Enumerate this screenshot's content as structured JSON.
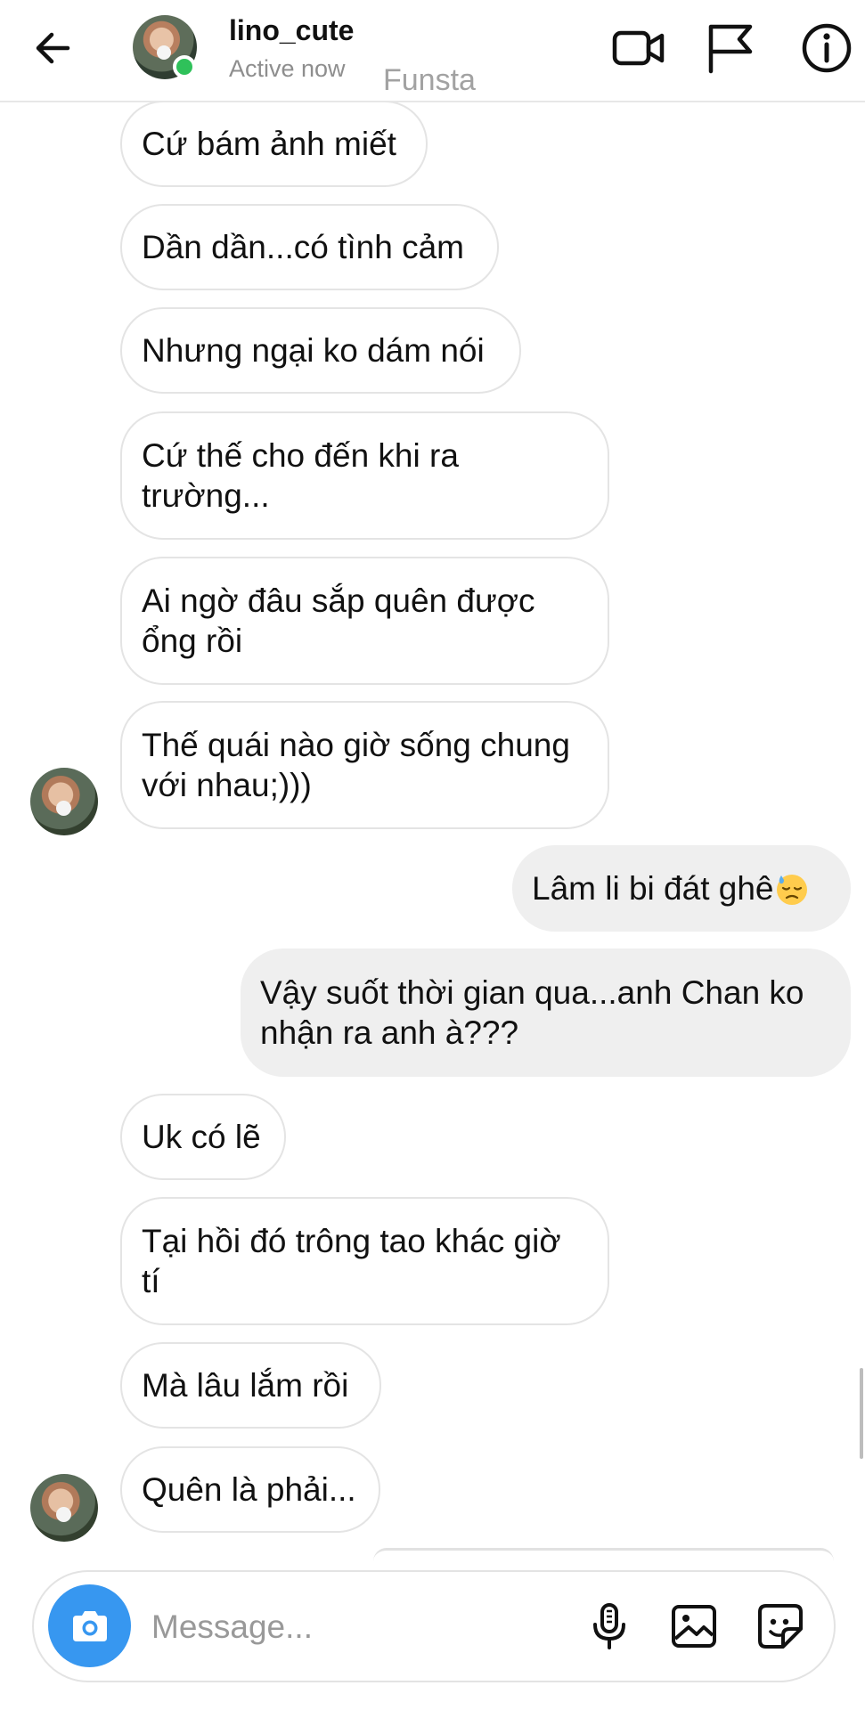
{
  "header": {
    "username": "lino_cute",
    "status": "Active now",
    "watermark": "Funsta"
  },
  "messages": [
    {
      "side": "in",
      "text": "Cứ bám ảnh miết"
    },
    {
      "side": "in",
      "text": "Dần dần...có tình cảm"
    },
    {
      "side": "in",
      "text": "Nhưng ngại ko dám nói"
    },
    {
      "side": "in",
      "text": "Cứ thế cho đến khi ra trường..."
    },
    {
      "side": "in",
      "text": "Ai ngờ đâu sắp quên được ổng rồi"
    },
    {
      "side": "in",
      "text": "Thế quái nào giờ sống chung với nhau;)))"
    },
    {
      "side": "out",
      "text": "Lâm li bi đát ghê"
    },
    {
      "side": "out",
      "text": "Vậy suốt thời gian qua...anh Chan ko nhận ra anh à???"
    },
    {
      "side": "in",
      "text": "Uk có lẽ"
    },
    {
      "side": "in",
      "text": "Tại hồi đó trông tao khác giờ tí"
    },
    {
      "side": "in",
      "text": "Mà lâu lắm rồi"
    },
    {
      "side": "in",
      "text": "Quên là phải..."
    }
  ],
  "composer": {
    "placeholder": "Message..."
  },
  "icons": {
    "back": "arrow-left-icon",
    "video": "video-camera-icon",
    "report": "flag-icon",
    "info": "info-icon",
    "camera": "camera-icon",
    "mic": "microphone-icon",
    "gallery": "image-icon",
    "sticker": "sticker-icon",
    "emoji": "downcast-sweat-emoji"
  },
  "colors": {
    "accent": "#3797f0",
    "online": "#2fc15a",
    "outgoing_bubble": "#efefef"
  }
}
